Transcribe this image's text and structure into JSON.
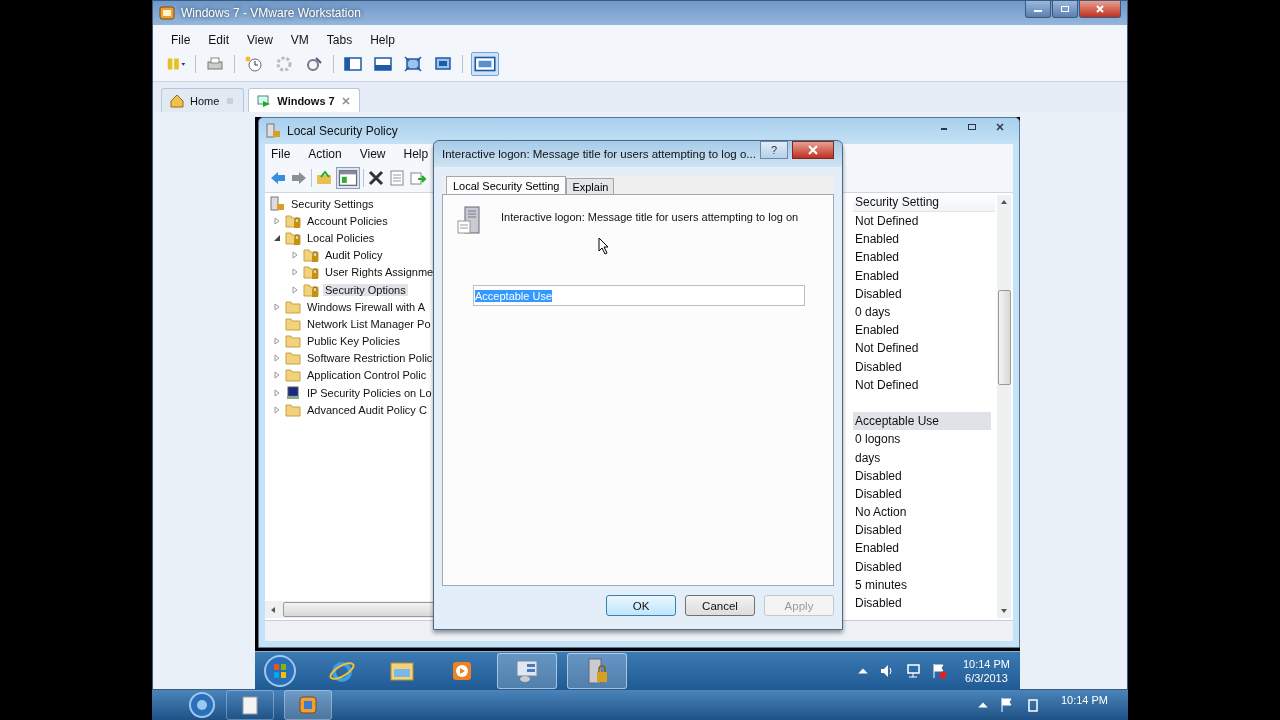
{
  "window": {
    "title": "Windows 7 - VMware Workstation"
  },
  "menu": [
    "File",
    "Edit",
    "View",
    "VM",
    "Tabs",
    "Help"
  ],
  "tabs": [
    {
      "label": "Home",
      "selected": false
    },
    {
      "label": "Windows 7",
      "selected": true
    }
  ],
  "policy_window": {
    "title": "Local Security Policy",
    "menu": [
      "File",
      "Action",
      "View",
      "Help"
    ],
    "tree": [
      {
        "label": "Security Settings",
        "kind": "root",
        "selected": false,
        "children": [
          {
            "label": "Account Policies",
            "kind": "locked",
            "expanded": false,
            "selected": false
          },
          {
            "label": "Local Policies",
            "kind": "locked",
            "expanded": true,
            "selected": false,
            "children": [
              {
                "label": "Audit Policy",
                "kind": "locked",
                "expanded": false,
                "selected": false
              },
              {
                "label": "User Rights Assignme",
                "kind": "locked",
                "expanded": false,
                "selected": false
              },
              {
                "label": "Security Options",
                "kind": "locked",
                "expanded": false,
                "selected": true
              }
            ]
          },
          {
            "label": "Windows Firewall with A",
            "kind": "folder",
            "expanded": false,
            "selected": false
          },
          {
            "label": "Network List Manager Po",
            "kind": "folder",
            "selected": false
          },
          {
            "label": "Public Key Policies",
            "kind": "folder",
            "expanded": false,
            "selected": false
          },
          {
            "label": "Software Restriction Polic",
            "kind": "folder",
            "expanded": false,
            "selected": false
          },
          {
            "label": "Application Control Polic",
            "kind": "folder",
            "expanded": false,
            "selected": false
          },
          {
            "label": "IP Security Policies on Lo",
            "kind": "computer",
            "expanded": false,
            "selected": false
          },
          {
            "label": "Advanced Audit Policy C",
            "kind": "folder",
            "expanded": false,
            "selected": false
          }
        ]
      }
    ],
    "column_header": "Security Setting",
    "rows": [
      {
        "value": "Not Defined",
        "selected": false
      },
      {
        "value": "Enabled",
        "selected": false
      },
      {
        "value": "Enabled",
        "selected": false
      },
      {
        "value": "Enabled",
        "selected": false
      },
      {
        "value": "Disabled",
        "selected": false
      },
      {
        "value": "0 days",
        "selected": false
      },
      {
        "value": "Enabled",
        "selected": false
      },
      {
        "value": "Not Defined",
        "selected": false
      },
      {
        "value": "Disabled",
        "selected": false
      },
      {
        "value": "Not Defined",
        "selected": false
      },
      {
        "selected": false
      },
      {
        "value": "Acceptable Use",
        "selected": true
      },
      {
        "value": "0 logons",
        "selected": false
      },
      {
        "value": "days",
        "selected": false
      },
      {
        "value": "Disabled",
        "selected": false
      },
      {
        "value": "Disabled",
        "selected": false
      },
      {
        "value": "No Action",
        "selected": false
      },
      {
        "value": "Disabled",
        "selected": false
      },
      {
        "value": "Enabled",
        "selected": false
      },
      {
        "value": "Disabled",
        "selected": false
      },
      {
        "value": "5 minutes",
        "selected": false
      },
      {
        "value": "Disabled",
        "selected": false
      }
    ]
  },
  "dialog": {
    "title": "Interactive logon: Message title for users attempting to log o...",
    "help": "?",
    "tabs": [
      {
        "label": "Local Security Setting",
        "selected": true
      },
      {
        "label": "Explain",
        "selected": false
      }
    ],
    "description": "Interactive logon: Message title for users attempting to log on",
    "field": {
      "value": "Acceptable Use",
      "value_selected": true
    },
    "buttons": [
      {
        "label": "OK",
        "default": true,
        "disabled": false
      },
      {
        "label": "Cancel",
        "default": false,
        "disabled": false
      },
      {
        "label": "Apply",
        "default": false,
        "disabled": true
      }
    ]
  },
  "guest_taskbar": {
    "time": "10:14 PM",
    "date": "6/3/2013"
  },
  "host_taskbar": {
    "time": "10:14 PM"
  }
}
